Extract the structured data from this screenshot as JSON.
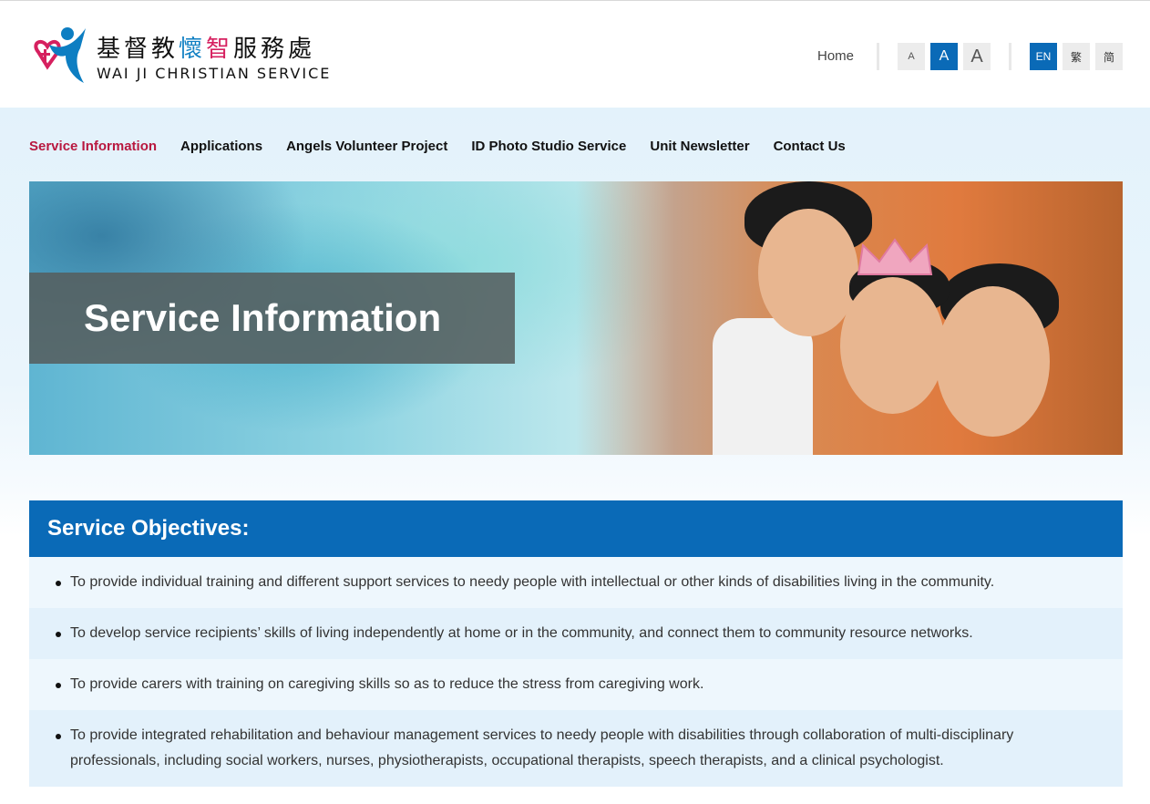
{
  "header": {
    "logo_zh_part1": "基督教",
    "logo_zh_part2": "懷",
    "logo_zh_part3": "智",
    "logo_zh_part4": "服務處",
    "logo_en": "WAI JI CHRISTIAN SERVICE",
    "home_label": "Home",
    "font_sizes": [
      "A",
      "A",
      "A"
    ],
    "languages": [
      "EN",
      "繁",
      "简"
    ]
  },
  "nav": {
    "items": [
      {
        "label": "Service Information",
        "active": true
      },
      {
        "label": "Applications"
      },
      {
        "label": "Angels Volunteer Project"
      },
      {
        "label": "ID Photo Studio Service"
      },
      {
        "label": "Unit Newsletter"
      },
      {
        "label": "Contact Us"
      }
    ]
  },
  "hero": {
    "title": "Service Information"
  },
  "objectives": {
    "heading": "Service Objectives:",
    "items": [
      "To provide individual training and different support services to needy people with intellectual or other kinds of disabilities living in the community.",
      "To develop service recipients’ skills of living independently at home or in the community, and connect them to community resource networks.",
      "To provide carers with training on caregiving skills so as to reduce the stress from caregiving work.",
      "To provide integrated rehabilitation and behaviour management services to needy people with disabilities through collaboration of multi-disciplinary professionals, including social workers, nurses, physiotherapists, occupational therapists, speech therapists, and a clinical psychologist."
    ]
  },
  "colors": {
    "brand_blue": "#0a6ab7",
    "active_nav": "#b8183f",
    "logo_pink": "#d6205f"
  },
  "icons": {
    "logo": "wai-ji-logo-icon"
  }
}
